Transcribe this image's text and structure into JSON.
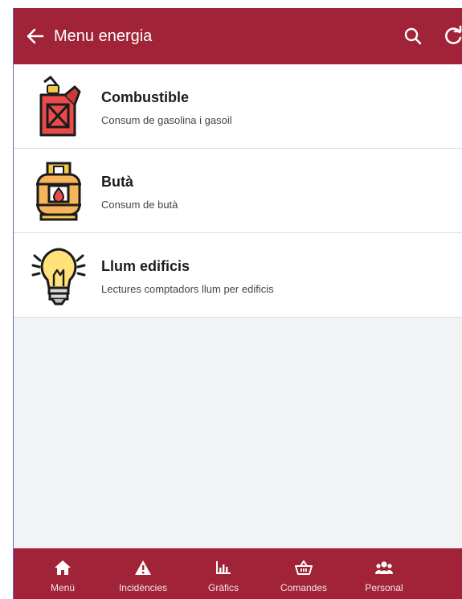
{
  "header": {
    "title": "Menu energia",
    "back_icon": "arrow-left-icon",
    "search_icon": "search-icon",
    "refresh_icon": "refresh-icon"
  },
  "items": [
    {
      "name": "Combustible",
      "description": "Consum de gasolina i gasoil",
      "icon": "fuel-can-icon"
    },
    {
      "name": "Butà",
      "description": "Consum de butà",
      "icon": "gas-cylinder-icon"
    },
    {
      "name": "Llum edificis",
      "description": "Lectures comptadors llum per edificis",
      "icon": "light-bulb-icon"
    }
  ],
  "bottom_nav": [
    {
      "label": "Menú",
      "icon": "home-icon"
    },
    {
      "label": "Incidències",
      "icon": "warning-icon"
    },
    {
      "label": "Gràfics",
      "icon": "bar-chart-icon"
    },
    {
      "label": "Comandes",
      "icon": "basket-icon"
    },
    {
      "label": "Personal",
      "icon": "users-icon"
    }
  ],
  "colors": {
    "primary": "#a02337",
    "list_background": "#ffffff",
    "page_background": "#f2f3f5"
  }
}
